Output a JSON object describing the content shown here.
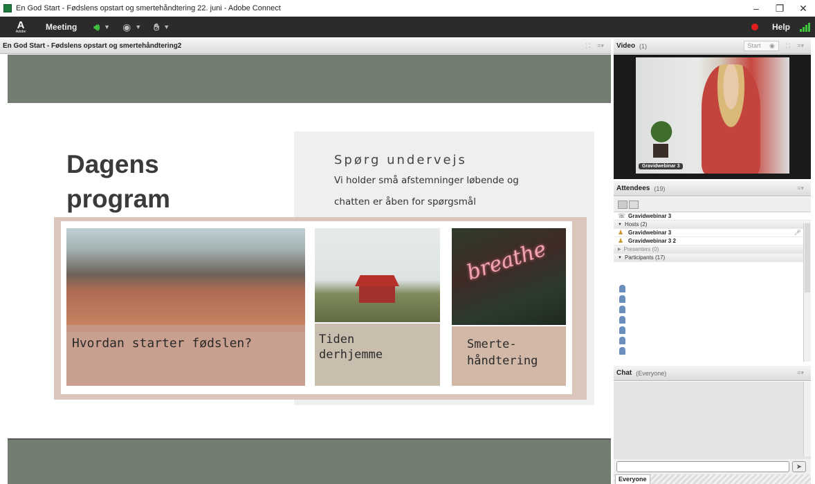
{
  "window": {
    "title": "En God Start - Fødslens opstart og smertehåndtering 22. juni - Adobe Connect",
    "controls": [
      "minimize",
      "restore",
      "close"
    ]
  },
  "menubar": {
    "logo_label": "Adobe",
    "meeting_label": "Meeting",
    "help_label": "Help",
    "icons": [
      "speaker-icon",
      "webcam-icon",
      "raise-hand-icon",
      "record-icon",
      "signal-icon"
    ]
  },
  "share_pod": {
    "title": "En God Start - Fødslens opstart og smertehåndtering2"
  },
  "slide": {
    "heading": "Dagens program",
    "ask_title": "Spørg undervejs",
    "ask_line1": "Vi holder små afstemninger løbende og",
    "ask_line2": "chatten er åben for spørgsmål",
    "cards": [
      {
        "caption": "Hvordan starter fødslen?"
      },
      {
        "caption_line1": "Tiden",
        "caption_line2": "derhjemme"
      },
      {
        "caption_line1": "Smerte-",
        "caption_line2": "håndtering",
        "image_text": "breathe"
      }
    ]
  },
  "video_pod": {
    "title": "Video",
    "count": "(1)",
    "start_label": "Start",
    "feed_label": "Gravidwebinar 3"
  },
  "attendees_pod": {
    "title": "Attendees",
    "count": "(19)",
    "me": "Gravidwebinar 3",
    "groups": [
      {
        "label": "Hosts (2)",
        "expanded": true,
        "members": [
          "Gravidwebinar 3",
          "Gravidwebinar 3 2"
        ]
      },
      {
        "label": "Presenters (0)",
        "expanded": false,
        "members": []
      },
      {
        "label": "Participants (17)",
        "expanded": true
      }
    ]
  },
  "chat_pod": {
    "title": "Chat",
    "scope": "(Everyone)",
    "tab_label": "Everyone",
    "input_value": ""
  },
  "colors": {
    "menubar_bg": "#2b2b2b",
    "share_bg": "#737d72",
    "frame": "#dbc6bb",
    "speaker_green": "#3fc43f",
    "record_red": "#e02020"
  }
}
